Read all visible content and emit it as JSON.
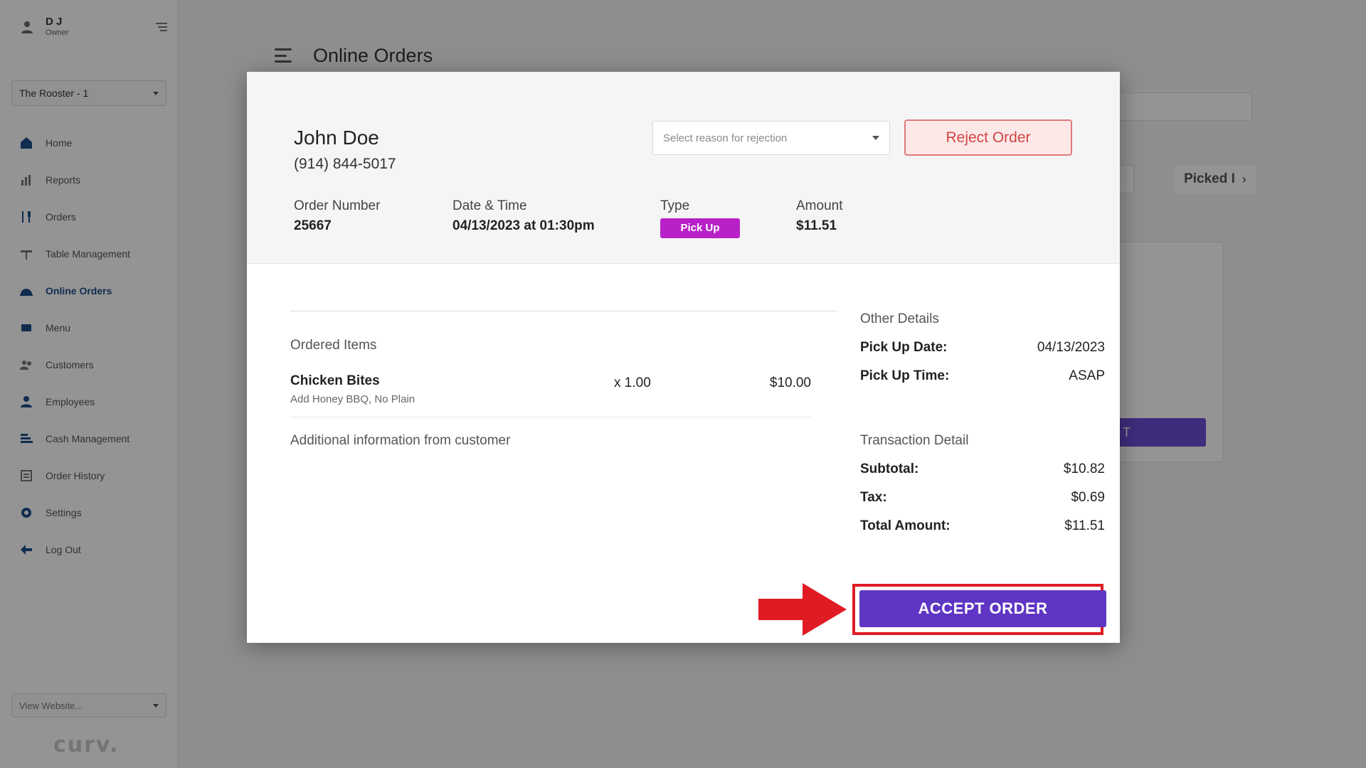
{
  "app": {
    "user_name": "D J",
    "user_role": "Owner",
    "store": "The Rooster - 1",
    "brand": "curv.",
    "website_select": "View Website...",
    "page_title": "Online Orders",
    "nav": [
      {
        "label": "Home",
        "icon": "home-icon"
      },
      {
        "label": "Reports",
        "icon": "chart-icon"
      },
      {
        "label": "Orders",
        "icon": "utensils-icon"
      },
      {
        "label": "Table Management",
        "icon": "table-icon"
      },
      {
        "label": "Online Orders",
        "icon": "cloche-icon"
      },
      {
        "label": "Menu",
        "icon": "menu-book-icon"
      },
      {
        "label": "Customers",
        "icon": "customers-icon"
      },
      {
        "label": "Employees",
        "icon": "employee-icon"
      },
      {
        "label": "Cash Management",
        "icon": "cash-icon"
      },
      {
        "label": "Order History",
        "icon": "history-icon"
      },
      {
        "label": "Settings",
        "icon": "gear-icon"
      },
      {
        "label": "Log Out",
        "icon": "logout-icon"
      }
    ],
    "bg_tab_picked": "Picked I",
    "bg_card_button": "T",
    "accent_color": "#5f35c3"
  },
  "modal": {
    "customer_name": "John Doe",
    "customer_phone": "(914) 844-5017",
    "rejection_select_placeholder": "Select reason for rejection",
    "reject_button": "Reject Order",
    "order_number_label": "Order Number",
    "order_number": "25667",
    "datetime_label": "Date & Time",
    "datetime": "04/13/2023 at 01:30pm",
    "type_label": "Type",
    "type": "Pick Up",
    "amount_label": "Amount",
    "amount": "$11.51",
    "ordered_items_title": "Ordered Items",
    "items": [
      {
        "name": "Chicken Bites",
        "modifiers": "Add Honey BBQ, No Plain",
        "qty": "x 1.00",
        "price": "$10.00"
      }
    ],
    "additional_info_title": "Additional information from customer",
    "other_details_title": "Other Details",
    "pickup_date_label": "Pick Up Date:",
    "pickup_date": "04/13/2023",
    "pickup_time_label": "Pick Up Time:",
    "pickup_time": "ASAP",
    "transaction_title": "Transaction Detail",
    "subtotal_label": "Subtotal:",
    "subtotal": "$10.82",
    "tax_label": "Tax:",
    "tax": "$0.69",
    "total_label": "Total Amount:",
    "total": "$11.51",
    "accept_button": "ACCEPT ORDER",
    "type_badge_color": "#b821c8",
    "highlight_color": "#e01b24"
  }
}
